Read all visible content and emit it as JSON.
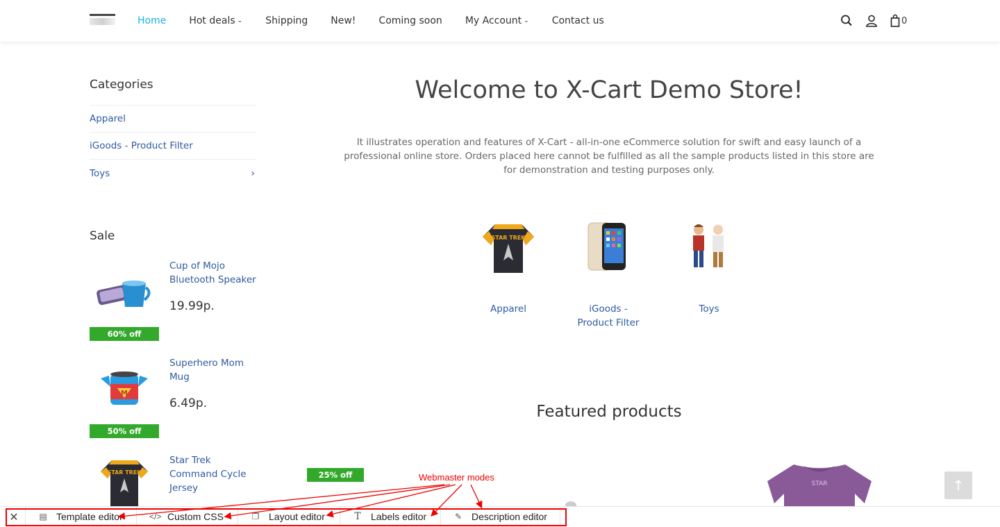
{
  "header": {
    "nav": [
      {
        "label": "Home",
        "active": true,
        "dropdown": false
      },
      {
        "label": "Hot deals",
        "active": false,
        "dropdown": true
      },
      {
        "label": "Shipping",
        "active": false,
        "dropdown": false
      },
      {
        "label": "New!",
        "active": false,
        "dropdown": false
      },
      {
        "label": "Coming soon",
        "active": false,
        "dropdown": false
      },
      {
        "label": "My Account",
        "active": false,
        "dropdown": true
      },
      {
        "label": "Contact us",
        "active": false,
        "dropdown": false
      }
    ],
    "cart_count": "0",
    "accent_color": "#1ab2e6"
  },
  "sidebar": {
    "categories_title": "Categories",
    "categories": [
      {
        "label": "Apparel"
      },
      {
        "label": "iGoods - Product Filter"
      },
      {
        "label": "Toys"
      }
    ],
    "sale_title": "Sale",
    "sale_items": [
      {
        "name": "Cup of Mojo Bluetooth Speaker",
        "price": "19.99р.",
        "badge": "60% off"
      },
      {
        "name": "Superhero Mom Mug",
        "price": "6.49р.",
        "badge": "50% off"
      },
      {
        "name": "Star Trek Command Cycle Jersey",
        "price": "",
        "badge": ""
      }
    ]
  },
  "main": {
    "welcome": "Welcome to X-Cart Demo Store!",
    "intro": "It illustrates operation and features of X-Cart - all-in-one eCommerce solution for swift and easy launch of a professional online store. Orders placed here cannot be fulfilled as all the sample products listed in this store are for demonstration and testing purposes only.",
    "category_tiles": [
      {
        "label": "Apparel"
      },
      {
        "label": "iGoods - Product Filter"
      },
      {
        "label": "Toys"
      }
    ],
    "featured_title": "Featured products",
    "featured_badge": "25% off"
  },
  "annotation": {
    "label": "Webmaster modes"
  },
  "webmaster_bar": {
    "buttons": [
      {
        "label": "Template editor",
        "icon": "template-icon"
      },
      {
        "label": "Custom CSS",
        "icon": "code-icon"
      },
      {
        "label": "Layout editor",
        "icon": "layout-icon"
      },
      {
        "label": "Labels editor",
        "icon": "text-icon"
      },
      {
        "label": "Description editor",
        "icon": "edit-icon"
      }
    ]
  },
  "colors": {
    "link": "#2c5aa0",
    "sale_badge": "#33a92b",
    "annotation": "#ee0000"
  }
}
